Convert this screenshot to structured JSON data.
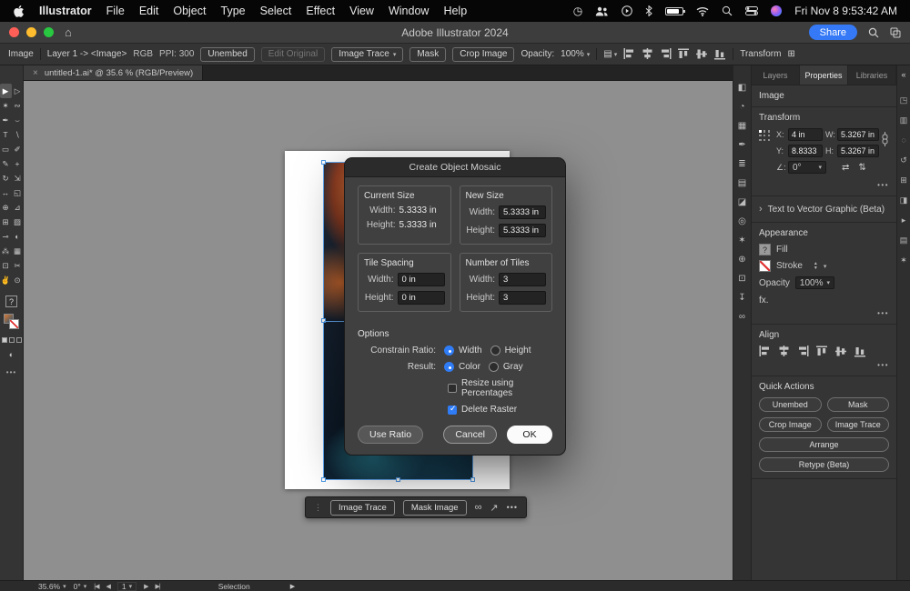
{
  "menubar": {
    "app_name": "Illustrator",
    "menus": [
      "File",
      "Edit",
      "Object",
      "Type",
      "Select",
      "Effect",
      "View",
      "Window",
      "Help"
    ],
    "clock": "Fri Nov 8 9:53:42 AM"
  },
  "titlebar": {
    "title": "Adobe Illustrator 2024",
    "share": "Share"
  },
  "controlbar": {
    "context": "Image",
    "layer_path": "Layer 1 -> <Image>",
    "color_mode": "RGB",
    "ppi": "PPI: 300",
    "unembed": "Unembed",
    "edit_original": "Edit Original",
    "image_trace": "Image Trace",
    "mask": "Mask",
    "crop_image": "Crop Image",
    "opacity_label": "Opacity:",
    "opacity": "100%",
    "transform": "Transform"
  },
  "tab": {
    "title": "untitled-1.ai* @ 35.6 % (RGB/Preview)"
  },
  "tools": [
    {
      "name": "selection-tool",
      "glyph": "▶",
      "active": true
    },
    {
      "name": "direct-selection-tool",
      "glyph": "▷"
    },
    {
      "name": "magic-wand-tool",
      "glyph": "✶"
    },
    {
      "name": "lasso-tool",
      "glyph": "∾"
    },
    {
      "name": "pen-tool",
      "glyph": "✒"
    },
    {
      "name": "curvature-tool",
      "glyph": "⌣"
    },
    {
      "name": "type-tool",
      "glyph": "T"
    },
    {
      "name": "line-segment-tool",
      "glyph": "∖"
    },
    {
      "name": "rectangle-tool",
      "glyph": "▭"
    },
    {
      "name": "paintbrush-tool",
      "glyph": "✐"
    },
    {
      "name": "pencil-tool",
      "glyph": "✎"
    },
    {
      "name": "shaper-tool",
      "glyph": "+"
    },
    {
      "name": "rotate-tool",
      "glyph": "↻"
    },
    {
      "name": "scale-tool",
      "glyph": "⇲"
    },
    {
      "name": "width-tool",
      "glyph": "↔"
    },
    {
      "name": "free-transform-tool",
      "glyph": "◱"
    },
    {
      "name": "shape-builder-tool",
      "glyph": "⊕"
    },
    {
      "name": "perspective-grid-tool",
      "glyph": "⊿"
    },
    {
      "name": "mesh-tool",
      "glyph": "⊞"
    },
    {
      "name": "gradient-tool",
      "glyph": "▨"
    },
    {
      "name": "eyedropper-tool",
      "glyph": "⊸"
    },
    {
      "name": "blend-tool",
      "glyph": "◐"
    },
    {
      "name": "symbol-sprayer-tool",
      "glyph": "⁂"
    },
    {
      "name": "column-graph-tool",
      "glyph": "▦"
    },
    {
      "name": "artboard-tool",
      "glyph": "⊡"
    },
    {
      "name": "slice-tool",
      "glyph": "✂"
    },
    {
      "name": "hand-tool",
      "glyph": "✌"
    },
    {
      "name": "zoom-tool",
      "glyph": "⊙"
    }
  ],
  "tool_extras": {
    "fill_indicator": "?"
  },
  "panel_dock": [
    {
      "name": "color-panel-icon",
      "glyph": "◧"
    },
    {
      "name": "color-guide-panel-icon",
      "glyph": "◔"
    },
    {
      "name": "swatches-panel-icon",
      "glyph": "▦"
    },
    {
      "name": "brushes-panel-icon",
      "glyph": "✒"
    },
    {
      "name": "stroke-panel-icon",
      "glyph": "≣"
    },
    {
      "name": "gradient-panel-icon",
      "glyph": "▤"
    },
    {
      "name": "transparency-panel-icon",
      "glyph": "◪"
    },
    {
      "name": "appearance-panel-icon",
      "glyph": "◎"
    },
    {
      "name": "graphic-styles-panel-icon",
      "glyph": "✶"
    },
    {
      "name": "symbols-panel-icon",
      "glyph": "⊕"
    },
    {
      "name": "artboards-panel-icon",
      "glyph": "⊡"
    },
    {
      "name": "asset-export-panel-icon",
      "glyph": "↧"
    },
    {
      "name": "links-panel-icon",
      "glyph": "∞"
    }
  ],
  "right_dock": [
    {
      "name": "learn-panel-icon",
      "glyph": "◳"
    },
    {
      "name": "libraries-panel-icon",
      "glyph": "▥"
    },
    {
      "name": "comments-panel-icon",
      "glyph": "◌"
    },
    {
      "name": "history-panel-icon",
      "glyph": "↺"
    },
    {
      "name": "navigator-panel-icon",
      "glyph": "⊞"
    },
    {
      "name": "info-panel-icon",
      "glyph": "◨"
    },
    {
      "name": "actions-panel-icon",
      "glyph": "▸"
    },
    {
      "name": "layers-dock-icon",
      "glyph": "▤"
    },
    {
      "name": "discover-panel-icon",
      "glyph": "✶"
    }
  ],
  "dialog": {
    "title": "Create Object Mosaic",
    "current_size": {
      "heading": "Current Size",
      "width_label": "Width:",
      "width": "5.3333 in",
      "height_label": "Height:",
      "height": "5.3333 in"
    },
    "new_size": {
      "heading": "New Size",
      "width_label": "Width:",
      "width": "5.3333 in",
      "height_label": "Height:",
      "height": "5.3333 in"
    },
    "tile_spacing": {
      "heading": "Tile Spacing",
      "width_label": "Width:",
      "width": "0 in",
      "height_label": "Height:",
      "height": "0 in"
    },
    "tiles": {
      "heading": "Number of Tiles",
      "width_label": "Width:",
      "width": "3",
      "height_label": "Height:",
      "height": "3"
    },
    "options": {
      "heading": "Options",
      "constrain_label": "Constrain Ratio:",
      "width_option": "Width",
      "height_option": "Height",
      "width_selected": true,
      "height_selected": false,
      "result_label": "Result:",
      "color_option": "Color",
      "gray_option": "Gray",
      "color_selected": true,
      "gray_selected": false,
      "resize_label": "Resize using Percentages",
      "resize_checked": false,
      "delete_label": "Delete Raster",
      "delete_checked": true
    },
    "buttons": {
      "use_ratio": "Use Ratio",
      "cancel": "Cancel",
      "ok": "OK"
    }
  },
  "float_bar": {
    "image_trace": "Image Trace",
    "mask_image": "Mask Image"
  },
  "panel": {
    "tabs": [
      {
        "name": "tab-layers",
        "label": "Layers"
      },
      {
        "name": "tab-properties",
        "label": "Properties",
        "active": true
      },
      {
        "name": "tab-libraries",
        "label": "Libraries"
      }
    ],
    "image_label": "Image",
    "transform": {
      "heading": "Transform",
      "x_label": "X:",
      "x": "4 in",
      "y_label": "Y:",
      "y": "8.8333 in",
      "w_label": "W:",
      "w": "5.3267 in",
      "h_label": "H:",
      "h": "5.3267 in",
      "angle_label": "∠:",
      "angle": "0°"
    },
    "t2v": "Text to Vector Graphic (Beta)",
    "appearance": {
      "heading": "Appearance",
      "fill": "Fill",
      "stroke": "Stroke",
      "opacity_label": "Opacity",
      "opacity": "100%",
      "fx": "fx."
    },
    "align_heading": "Align",
    "quick_heading": "Quick Actions",
    "quick_buttons": [
      {
        "name": "quick-action-unembed",
        "label": "Unembed"
      },
      {
        "name": "quick-action-mask",
        "label": "Mask"
      },
      {
        "name": "quick-action-crop-image",
        "label": "Crop Image"
      },
      {
        "name": "quick-action-image-trace",
        "label": "Image Trace"
      },
      {
        "name": "quick-action-arrange",
        "label": "Arrange",
        "wide": true
      },
      {
        "name": "quick-action-retype",
        "label": "Retype (Beta)",
        "wide": true
      }
    ]
  },
  "status": {
    "zoom": "35.6%",
    "rotation": "0°",
    "page": "1",
    "mode": "Selection"
  },
  "icons": {
    "chevron": "▾",
    "more": "•••",
    "close": "×",
    "home": "⌂",
    "collapse": "«",
    "disclosure": "›",
    "link": "∞",
    "launch": "↗",
    "flip_h": "⇄",
    "flip_v": "⇅",
    "style": "▤",
    "grid": "⊞",
    "first": "|◀",
    "prev": "◀",
    "next": "▶",
    "last": "▶|",
    "handle": "⋮",
    "clock_status": "◷",
    "stepper_up": "▲",
    "stepper_down": "▼",
    "screen_mode": "◐"
  }
}
